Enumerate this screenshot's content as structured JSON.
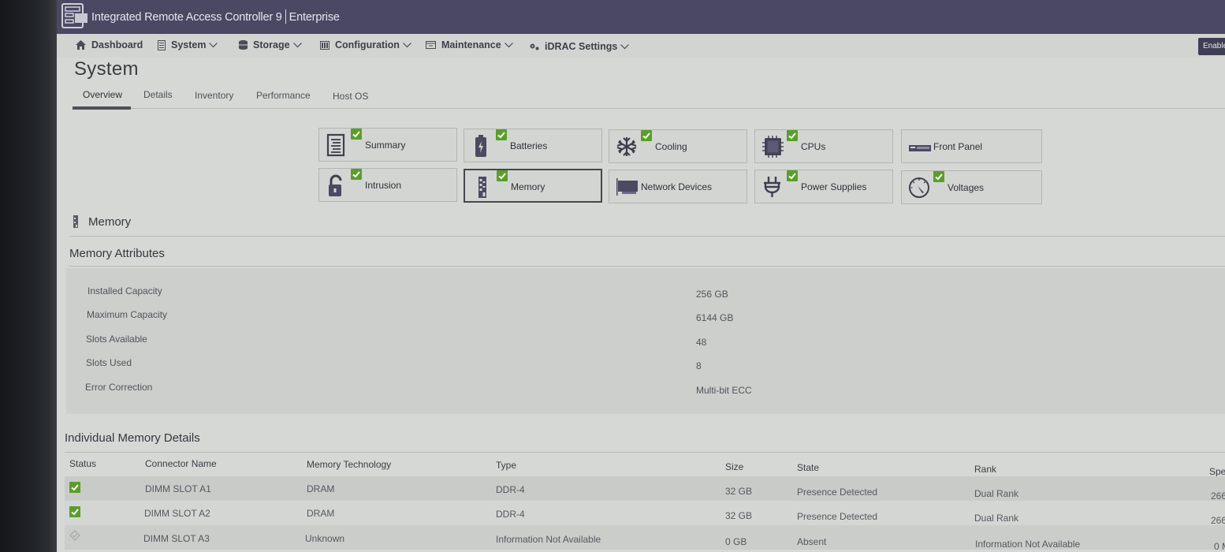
{
  "header": {
    "app_title": "Integrated Remote Access Controller 9",
    "edition": "Enterprise",
    "logo_icon": "server-rack-icon",
    "enable_button": "Enable"
  },
  "nav": {
    "items": [
      {
        "label": "Dashboard",
        "icon": "home-icon",
        "dropdown": false
      },
      {
        "label": "System",
        "icon": "server-icon",
        "dropdown": true
      },
      {
        "label": "Storage",
        "icon": "database-icon",
        "dropdown": true
      },
      {
        "label": "Configuration",
        "icon": "config-icon",
        "dropdown": true
      },
      {
        "label": "Maintenance",
        "icon": "maintenance-icon",
        "dropdown": true
      },
      {
        "label": "iDRAC Settings",
        "icon": "gears-icon",
        "dropdown": true
      }
    ]
  },
  "page": {
    "title": "System",
    "tabs": [
      {
        "label": "Overview",
        "active": true
      },
      {
        "label": "Details",
        "active": false
      },
      {
        "label": "Inventory",
        "active": false
      },
      {
        "label": "Performance",
        "active": false
      },
      {
        "label": "Host OS",
        "active": false
      }
    ]
  },
  "components": [
    {
      "label": "Summary",
      "icon": "summary-list-icon",
      "status": "ok",
      "selected": false
    },
    {
      "label": "Batteries",
      "icon": "battery-icon",
      "status": "ok",
      "selected": false
    },
    {
      "label": "Cooling",
      "icon": "snowflake-icon",
      "status": "ok",
      "selected": false
    },
    {
      "label": "CPUs",
      "icon": "cpu-chip-icon",
      "status": "ok",
      "selected": false
    },
    {
      "label": "Front Panel",
      "icon": "front-panel-icon",
      "status": "none",
      "selected": false
    },
    {
      "label": "Intrusion",
      "icon": "unlocked-padlock-icon",
      "status": "ok",
      "selected": false
    },
    {
      "label": "Memory",
      "icon": "memory-module-icon",
      "status": "ok",
      "selected": true
    },
    {
      "label": "Network Devices",
      "icon": "network-card-icon",
      "status": "none",
      "selected": false
    },
    {
      "label": "Power Supplies",
      "icon": "power-plug-icon",
      "status": "ok",
      "selected": false
    },
    {
      "label": "Voltages",
      "icon": "gauge-icon",
      "status": "ok",
      "selected": false
    }
  ],
  "memory": {
    "section_title": "Memory",
    "attributes_title": "Memory Attributes",
    "attributes": [
      {
        "label": "Installed Capacity",
        "value": "256 GB"
      },
      {
        "label": "Maximum Capacity",
        "value": "6144 GB"
      },
      {
        "label": "Slots Available",
        "value": "48"
      },
      {
        "label": "Slots Used",
        "value": "8"
      },
      {
        "label": "Error Correction",
        "value": "Multi-bit ECC"
      }
    ],
    "details_title": "Individual Memory Details",
    "columns": [
      "Status",
      "Connector Name",
      "Memory Technology",
      "Type",
      "Size",
      "State",
      "Rank",
      "Spe"
    ],
    "rows": [
      {
        "status": "ok",
        "connector": "DIMM SLOT A1",
        "technology": "DRAM",
        "type": "DDR-4",
        "size": "32 GB",
        "state": "Presence Detected",
        "rank": "Dual Rank",
        "speed": "266"
      },
      {
        "status": "ok",
        "connector": "DIMM SLOT A2",
        "technology": "DRAM",
        "type": "DDR-4",
        "size": "32 GB",
        "state": "Presence Detected",
        "rank": "Dual Rank",
        "speed": "266"
      },
      {
        "status": "unknown",
        "connector": "DIMM SLOT A3",
        "technology": "Unknown",
        "type": "Information Not Available",
        "size": "0 GB",
        "state": "Absent",
        "rank": "Information Not Available",
        "speed": "0 M"
      }
    ]
  },
  "colors": {
    "header_bg": "#4a4863",
    "status_ok": "#5a9e2a",
    "page_bg": "#d6d8d6"
  }
}
